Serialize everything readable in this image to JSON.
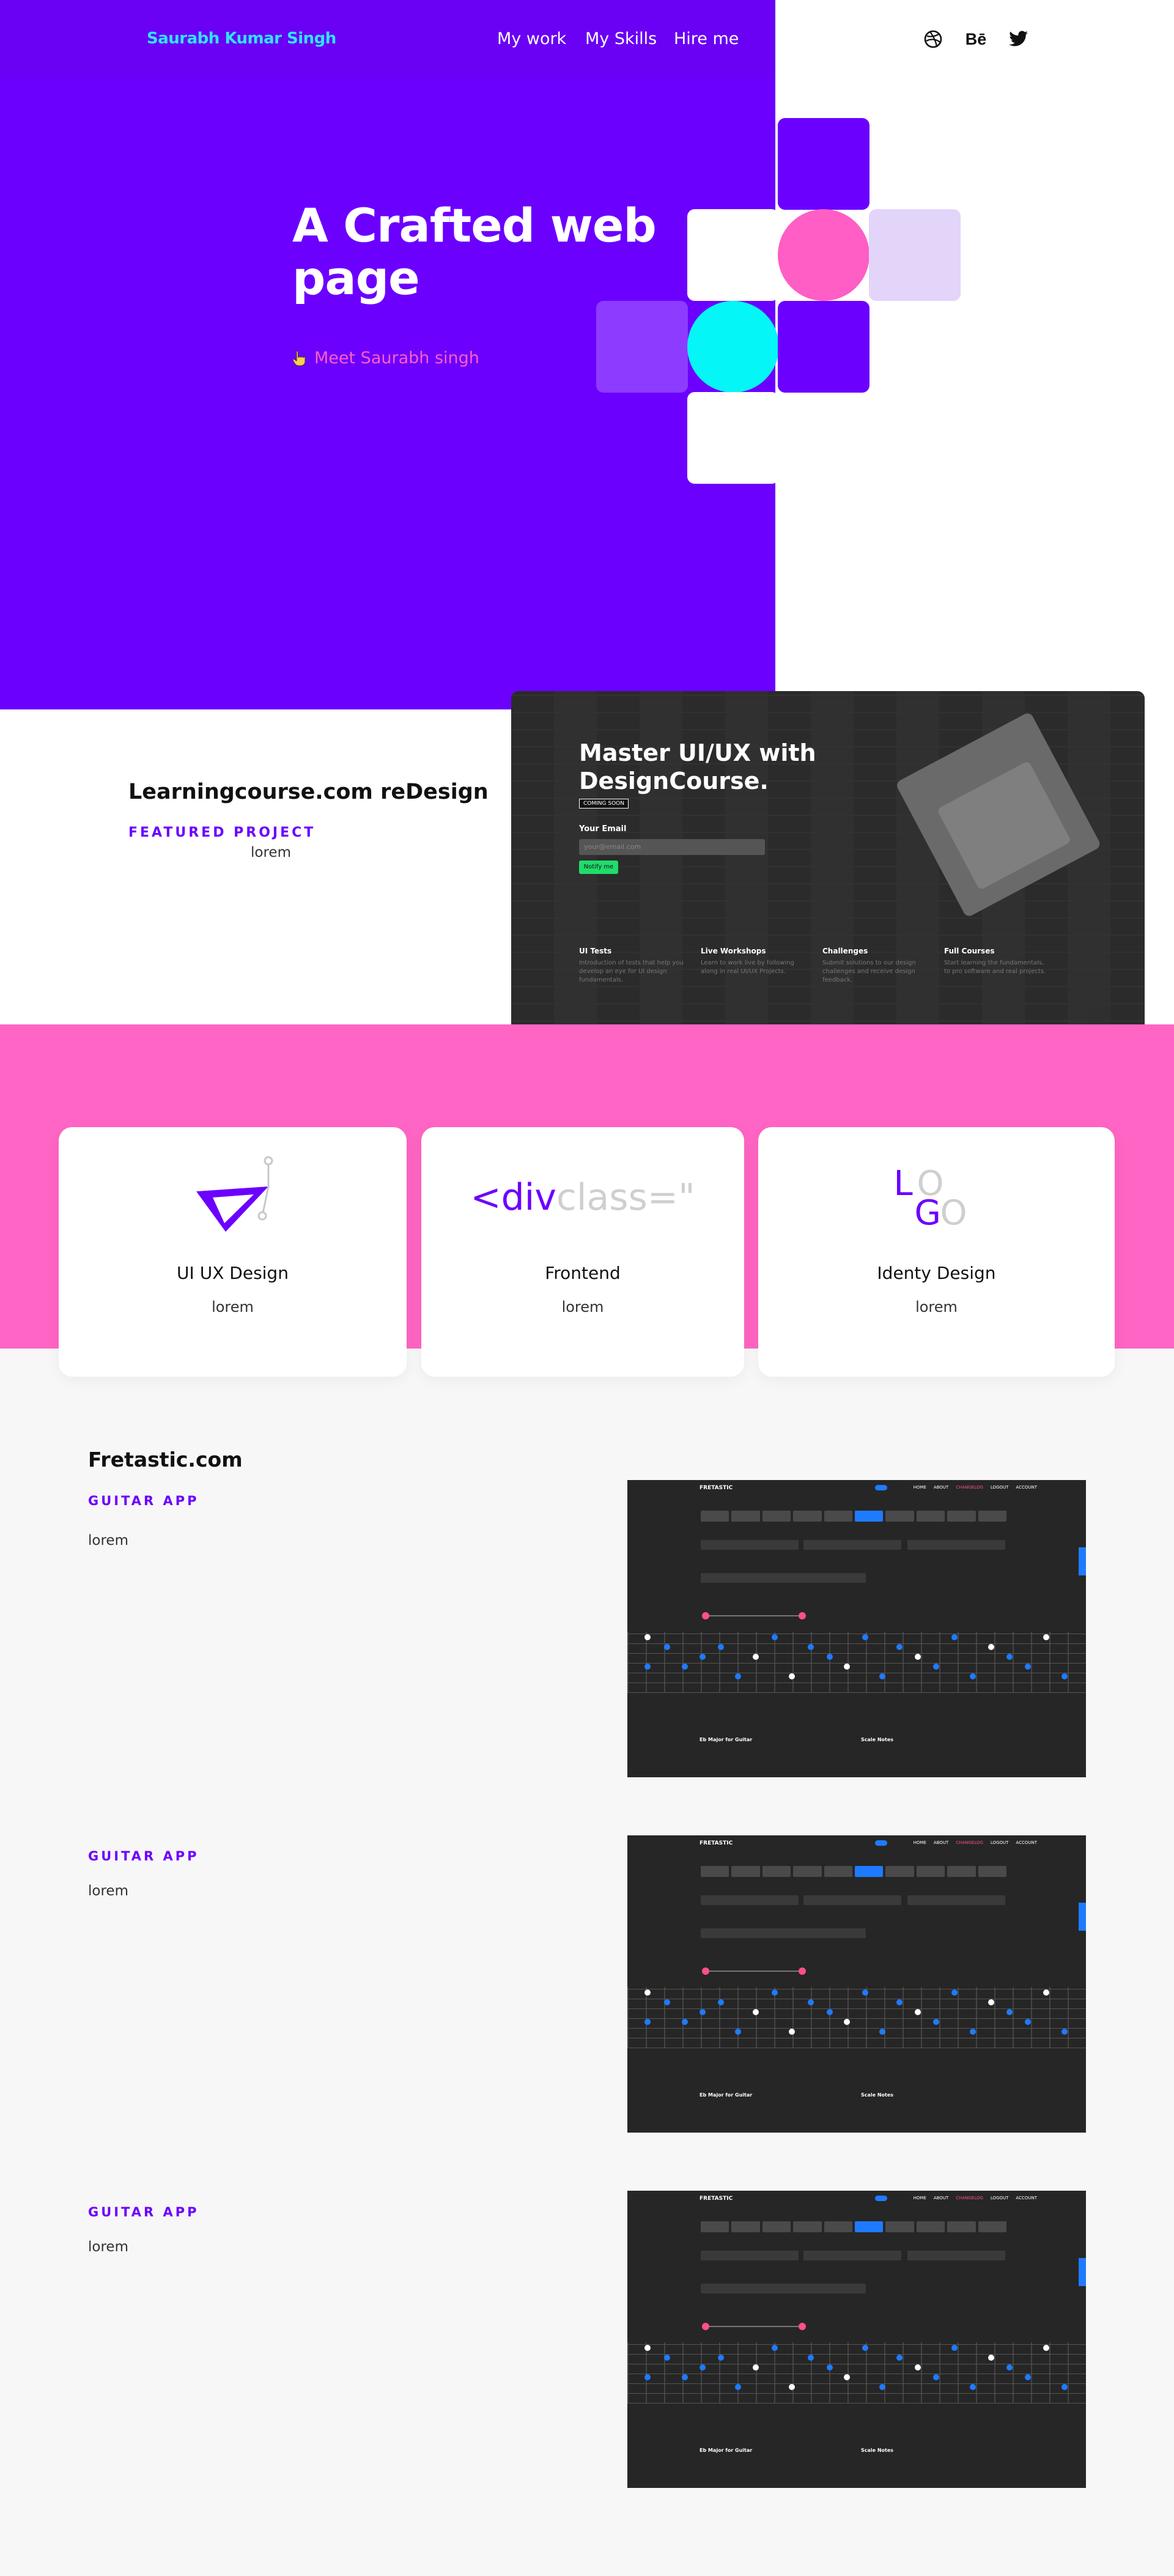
{
  "nav": {
    "brand": "Saurabh Kumar Singh",
    "links": [
      "My work",
      "My Skills",
      "Hire me"
    ],
    "social": [
      {
        "icon": "dribbble-icon"
      },
      {
        "icon": "behance-icon",
        "text": "Bē"
      },
      {
        "icon": "twitter-icon"
      }
    ]
  },
  "hero": {
    "title": "A Crafted web page",
    "cta": "Meet Saurabh singh",
    "colors": {
      "purple": "#6c00ff",
      "pink": "#ff5ec4",
      "cyan": "#05f6f6",
      "lavender": "#e3d4fa"
    }
  },
  "featured": {
    "title": "Learningcourse.com reDesign",
    "label": "FEATURED PROJECT",
    "desc": "lorem",
    "screenshot": {
      "headline_line1": "Master UI/UX with",
      "headline_line2": "DesignCourse.",
      "badge": "COMING SOON",
      "email_label": "Your Email",
      "email_placeholder": "your@email.com",
      "button": "Notify me",
      "features": [
        {
          "title": "UI Tests",
          "text": "Introduction of tests that help you develop an eye for UI design fundamentals."
        },
        {
          "title": "Live Workshops",
          "text": "Learn to work live by following along in real UI/UX Projects."
        },
        {
          "title": "Challenges",
          "text": "Submit solutions to our design challenges and receive design feedback."
        },
        {
          "title": "Full Courses",
          "text": "Start learning the fundamentals, to pro software and real projects."
        }
      ]
    }
  },
  "services": [
    {
      "title": "UI UX Design",
      "desc": "lorem",
      "icon": "pen-tool-icon"
    },
    {
      "title": "Frontend",
      "desc": "lorem",
      "code_a": "<div",
      "code_b": " class=\""
    },
    {
      "title": "Identy Design",
      "desc": "lorem",
      "icon": "logo-letters-icon",
      "letters": [
        "L",
        "O",
        "G",
        "O"
      ]
    }
  ],
  "apps": {
    "heading": "Fretastic.com",
    "items": [
      {
        "label": "GUITAR APP",
        "desc": "lorem"
      },
      {
        "label": "GUITAR APP",
        "desc": "lorem"
      },
      {
        "label": "GUITAR APP",
        "desc": "lorem"
      }
    ],
    "screenshot": {
      "logo": "FRETASTIC",
      "menu": [
        "HOME",
        "ABOUT",
        "CHANGELOG",
        "LOGOUT",
        "ACCOUNT"
      ],
      "footer_left": "Eb Major for Guitar",
      "footer_right": "Scale Notes"
    }
  }
}
